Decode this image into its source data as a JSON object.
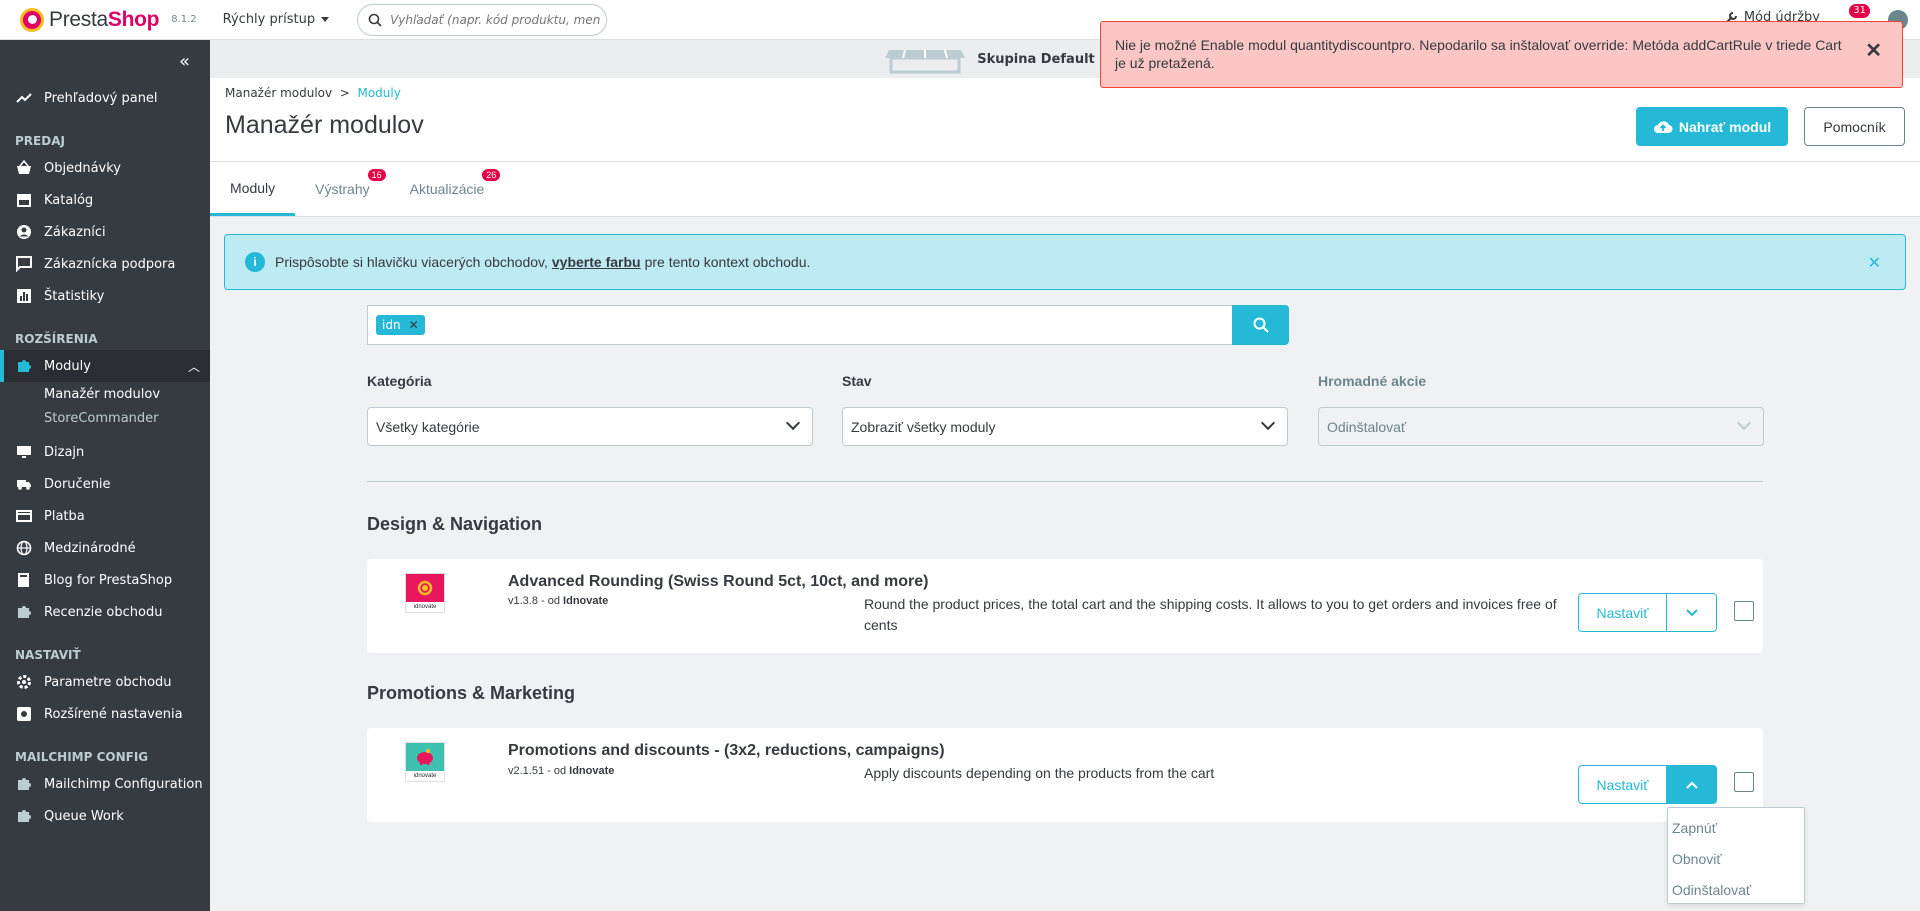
{
  "header": {
    "logo_text_a": "Presta",
    "logo_text_b": "Shop",
    "version": "8.1.2",
    "quick_access": "Rýchly prístup",
    "search_placeholder": "Vyhľadať (napr. kód produktu, meno z",
    "maintenance": "Mód údržby",
    "notif_count": "31"
  },
  "sidebar": {
    "dashboard": "Prehľadový panel",
    "section_sell": "PREDAJ",
    "orders": "Objednávky",
    "catalog": "Katalóg",
    "customers": "Zákazníci",
    "support": "Zákaznícka podpora",
    "stats": "Štatistiky",
    "section_ext": "ROZŠÍRENIA",
    "modules": "Moduly",
    "module_manager": "Manažér modulov",
    "storecommander": "StoreCommander",
    "design": "Dizajn",
    "shipping": "Doručenie",
    "payment": "Platba",
    "international": "Medzinárodné",
    "blog": "Blog for PrestaShop",
    "reviews": "Recenzie obchodu",
    "section_config": "NASTAVIŤ",
    "shop_params": "Parametre obchodu",
    "advanced": "Rozšírené nastavenia",
    "section_mailchimp": "MAILCHIMP CONFIG",
    "mailchimp_config": "Mailchimp Configuration",
    "queue": "Queue Work"
  },
  "shop_strip": {
    "label": "Skupina Default"
  },
  "page": {
    "breadcrumb_parent": "Manažér modulov",
    "breadcrumb_sep": ">",
    "breadcrumb_current": "Moduly",
    "title": "Manažér modulov",
    "upload_button": "Nahrať modul",
    "help_button": "Pomocník"
  },
  "tabs": [
    {
      "label": "Moduly",
      "badge": ""
    },
    {
      "label": "Výstrahy",
      "badge": "16"
    },
    {
      "label": "Aktualizácie",
      "badge": "26"
    }
  ],
  "info": {
    "text_before": "Prispôsobte si hlavičku viacerých obchodov,",
    "link": "vyberte farbu",
    "text_after": "pre tento kontext obchodu."
  },
  "filter": {
    "chip": "idn",
    "category_label": "Kategória",
    "category_value": "Všetky kategórie",
    "status_label": "Stav",
    "status_value": "Zobraziť všetky moduly",
    "bulk_label": "Hromadné akcie",
    "bulk_value": "Odinštalovať"
  },
  "categories": [
    {
      "title": "Design & Navigation",
      "module": {
        "name": "Advanced Rounding (Swiss Round 5ct, 10ct, and more)",
        "version": "v1.3.8 - od",
        "author": "Idnovate",
        "description": "Round the product prices, the total cart and the shipping costs. It allows to you to get orders and invoices free of cents",
        "config": "Nastaviť",
        "logo_brand": "idnovate"
      }
    },
    {
      "title": "Promotions & Marketing",
      "module": {
        "name": "Promotions and discounts - (3x2, reductions, campaigns)",
        "version": "v2.1.51 - od",
        "author": "Idnovate",
        "description": "Apply discounts depending on the products from the cart",
        "config": "Nastaviť",
        "logo_brand": "idnovate"
      }
    }
  ],
  "dropdown": [
    "Zapnúť",
    "Obnoviť",
    "Odinštalovať"
  ],
  "alert": {
    "message": "Nie je možné Enable modul quantitydiscountpro. Nepodarilo sa inštalovať override: Metóda addCartRule v triede Cart je už pretažená."
  },
  "colors": {
    "accent": "#25b9d7",
    "sidebar_bg": "#363a41",
    "alert_bg": "#fbc6c3",
    "brand_pink": "#df0067"
  }
}
